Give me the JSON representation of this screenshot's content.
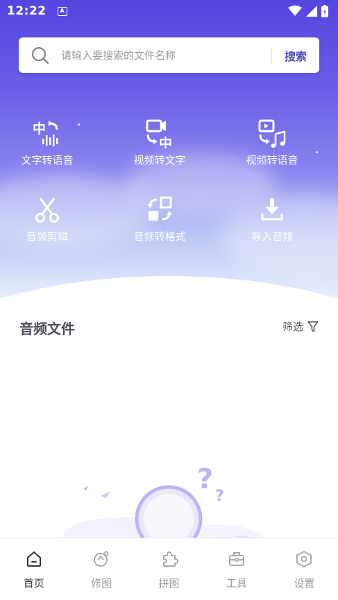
{
  "status_bar": {
    "time": "12:22",
    "notification_letter": "A"
  },
  "search": {
    "placeholder": "请输入要搜索的文件名称",
    "value": "",
    "button_label": "搜索"
  },
  "functions": [
    {
      "label": "文字转语音",
      "icon": "text-to-speech-icon"
    },
    {
      "label": "视频转文字",
      "icon": "video-to-text-icon"
    },
    {
      "label": "视频转语音",
      "icon": "video-to-audio-icon"
    },
    {
      "label": "音频剪辑",
      "icon": "scissors-icon"
    },
    {
      "label": "音频转格式",
      "icon": "format-convert-icon"
    },
    {
      "label": "导入音频",
      "icon": "import-icon"
    }
  ],
  "section": {
    "title": "音频文件",
    "filter_label": "筛选"
  },
  "bottom_nav": [
    {
      "label": "首页",
      "icon": "home-icon",
      "active": true
    },
    {
      "label": "修图",
      "icon": "retouch-icon",
      "active": false
    },
    {
      "label": "拼图",
      "icon": "puzzle-icon",
      "active": false
    },
    {
      "label": "工具",
      "icon": "toolbox-icon",
      "active": false
    },
    {
      "label": "设置",
      "icon": "settings-icon",
      "active": false
    }
  ],
  "colors": {
    "accent": "#5446df",
    "search_button": "#4f4bb8",
    "illustration": "#b9b6f2"
  }
}
